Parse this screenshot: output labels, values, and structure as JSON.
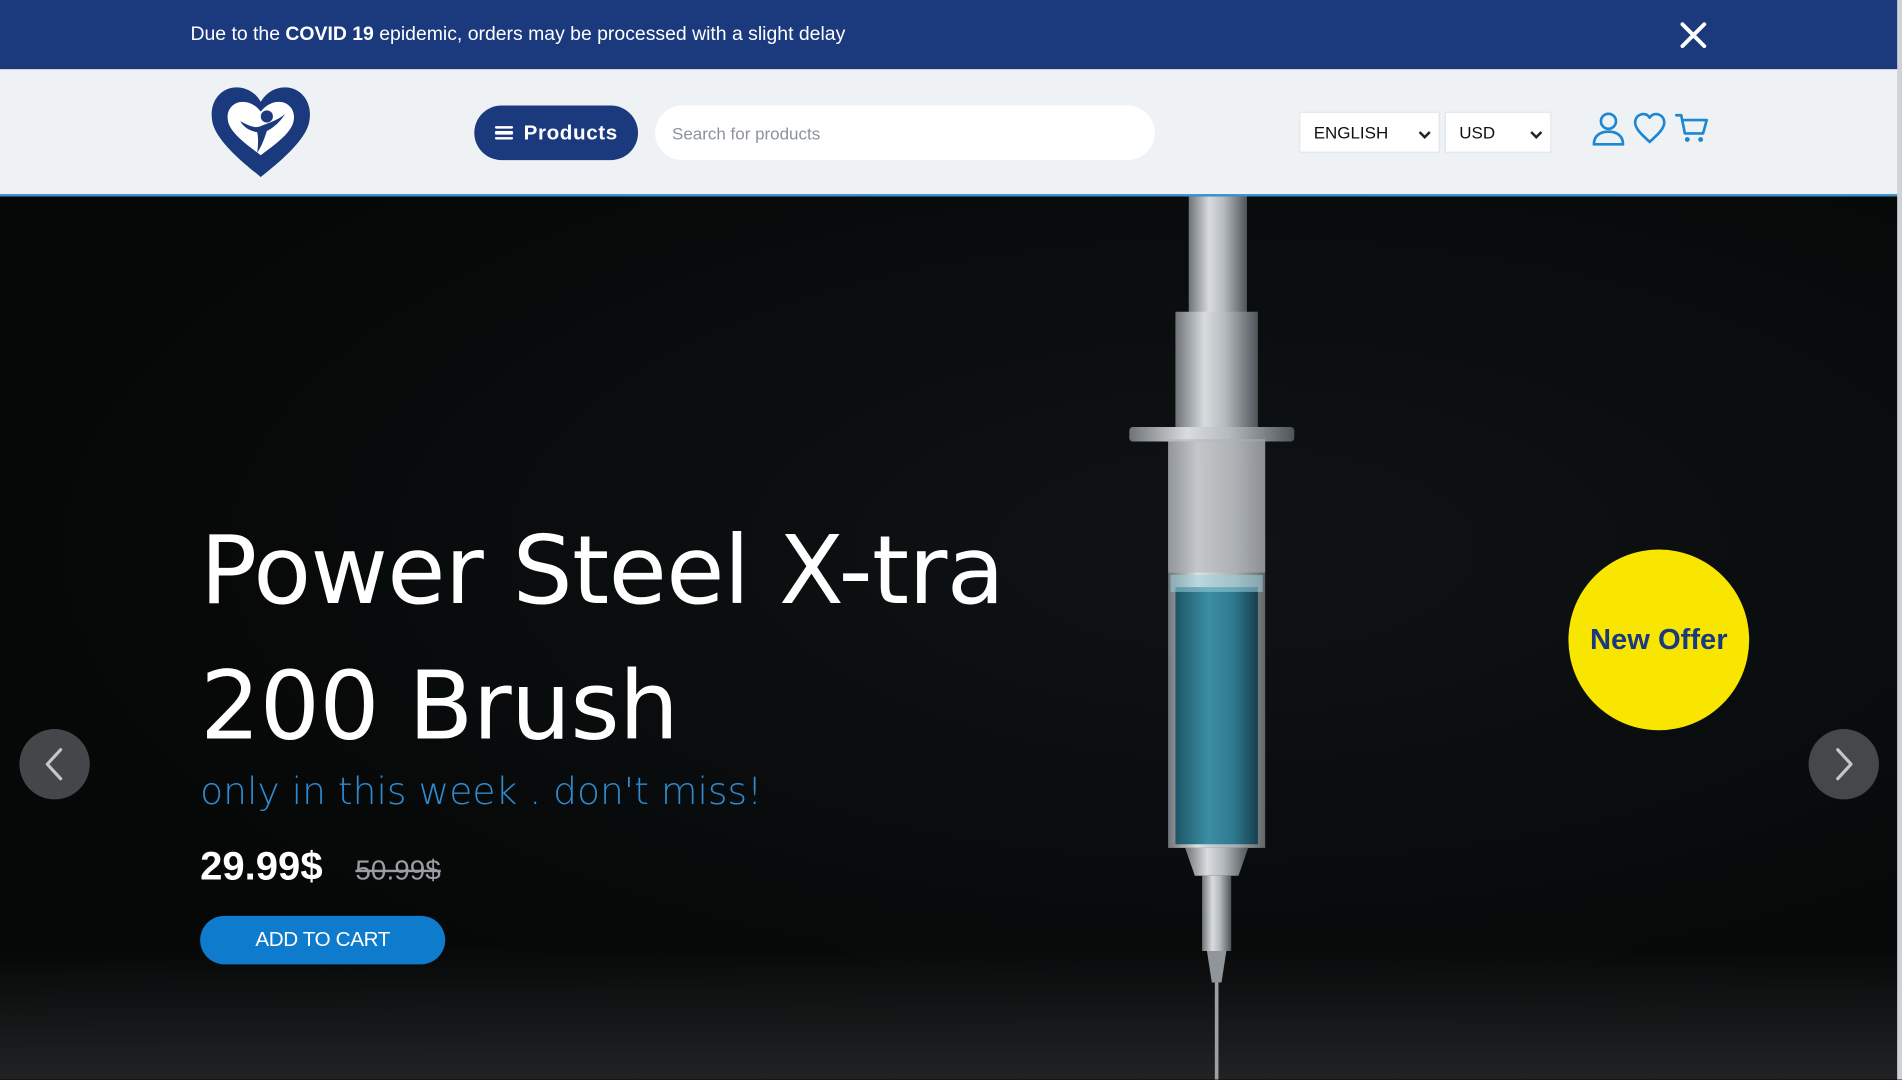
{
  "announcement": {
    "prefix": "Due to the ",
    "highlight": "COVID 19",
    "suffix": " epidemic, orders may be processed with a slight delay"
  },
  "header": {
    "products_label": "Products",
    "search_placeholder": "Search for products",
    "language": "ENGLISH",
    "currency": "USD"
  },
  "hero": {
    "title_line1": "Power Steel X-tra",
    "title_line2": "200 Brush",
    "subtitle": "only in this week . don't miss!",
    "price": "29.99$",
    "old_price": "50.99$",
    "cta": "ADD TO CART",
    "badge": "New Offer"
  },
  "colors": {
    "brand_navy": "#1b3a7e",
    "accent_blue": "#0f7bcc",
    "badge_yellow": "#f9e600"
  }
}
